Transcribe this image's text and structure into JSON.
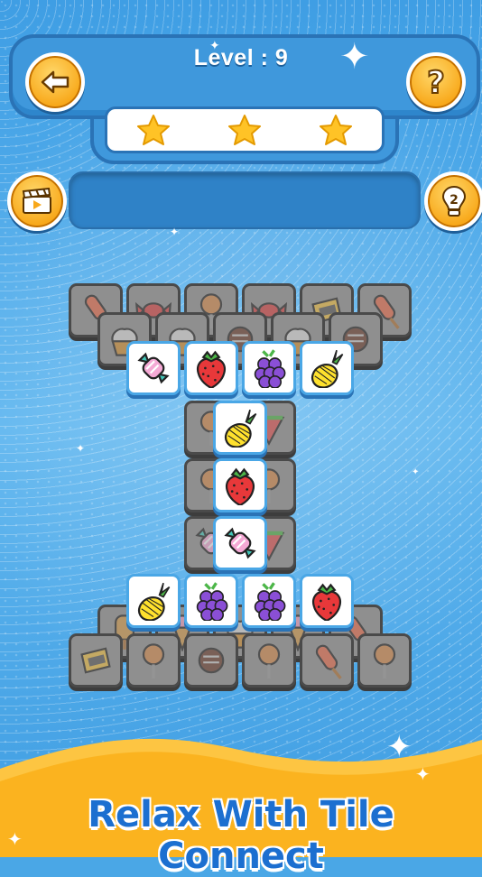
{
  "header": {
    "level_label": "Level : 9",
    "stars_earned": 3
  },
  "buttons": {
    "back_icon": "arrow-left-icon",
    "help_icon": "question-icon",
    "video_icon": "clapper-video-icon",
    "hint_icon": "lightbulb-icon",
    "hint_count": "2"
  },
  "banner": {
    "text": "Relax With Tile Connect"
  },
  "colors": {
    "accent": "#f8a81a",
    "bg": "#4aa7e6",
    "banner": "#fbb31f",
    "banner_text": "#1c6fd0"
  },
  "board": {
    "dim_tiles": [
      {
        "icon": "popsicle"
      },
      {
        "icon": "wrapped-candy"
      },
      {
        "icon": "lollipop"
      },
      {
        "icon": "wrapped-candy"
      },
      {
        "icon": "toffee"
      },
      {
        "icon": "popsicle"
      },
      {
        "icon": "cupcake"
      },
      {
        "icon": "cupcake"
      },
      {
        "icon": "chocolate"
      },
      {
        "icon": "cupcake"
      },
      {
        "icon": "chocolate"
      },
      {
        "icon": "lollipop"
      },
      {
        "icon": "watermelon"
      },
      {
        "icon": "lollipop"
      },
      {
        "icon": "lollipop"
      },
      {
        "icon": "candy"
      },
      {
        "icon": "watermelon"
      },
      {
        "icon": "ice-cream-bar"
      },
      {
        "icon": "cone"
      },
      {
        "icon": "cupcake"
      },
      {
        "icon": "cone"
      },
      {
        "icon": "popsicle"
      },
      {
        "icon": "toffee"
      },
      {
        "icon": "lollipop"
      },
      {
        "icon": "chocolate"
      },
      {
        "icon": "lollipop"
      },
      {
        "icon": "popsicle"
      },
      {
        "icon": "lollipop"
      }
    ],
    "active_tiles": [
      {
        "icon": "candy"
      },
      {
        "icon": "strawberry"
      },
      {
        "icon": "blackberry"
      },
      {
        "icon": "pineapple"
      },
      {
        "icon": "pineapple"
      },
      {
        "icon": "strawberry"
      },
      {
        "icon": "candy"
      },
      {
        "icon": "pineapple"
      },
      {
        "icon": "blackberry"
      },
      {
        "icon": "blackberry"
      },
      {
        "icon": "strawberry"
      }
    ]
  }
}
